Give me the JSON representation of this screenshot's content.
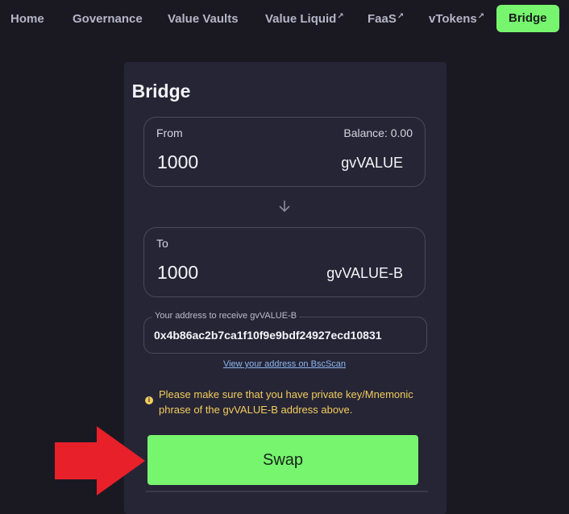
{
  "nav": {
    "items": [
      {
        "label": "Home"
      },
      {
        "label": "Governance"
      },
      {
        "label": "Value Vaults"
      },
      {
        "label": "Value Liquid",
        "external": "↗"
      },
      {
        "label": "FaaS",
        "external": "↗"
      },
      {
        "label": "vTokens",
        "external": "↗"
      },
      {
        "label": "Bridge"
      }
    ],
    "active": "Bridge"
  },
  "bridge": {
    "title": "Bridge",
    "from": {
      "label": "From",
      "balance": "Balance: 0.00",
      "amount": "1000",
      "token": "gvVALUE"
    },
    "to": {
      "label": "To",
      "amount": "1000",
      "token": "gvVALUE-B"
    },
    "address_label": "Your address to receive gvVALUE-B",
    "address_value": "0x4b86ac2b7ca1f10f9e9bdf24927ecd10831",
    "bscscan_link": "View your address on BscScan",
    "warning": "Please make sure that you have private key/Mnemonic phrase of the gvVALUE-B address above.",
    "swap_label": "Swap"
  },
  "colors": {
    "accent": "#77f56e",
    "background": "#1a1921",
    "card": "#262536",
    "warning": "#f2cd5c",
    "annotation_arrow": "#e8202a"
  },
  "icons": {
    "direction": "arrow-down-icon",
    "warning": "info-icon",
    "annotation": "red-arrow-icon"
  }
}
